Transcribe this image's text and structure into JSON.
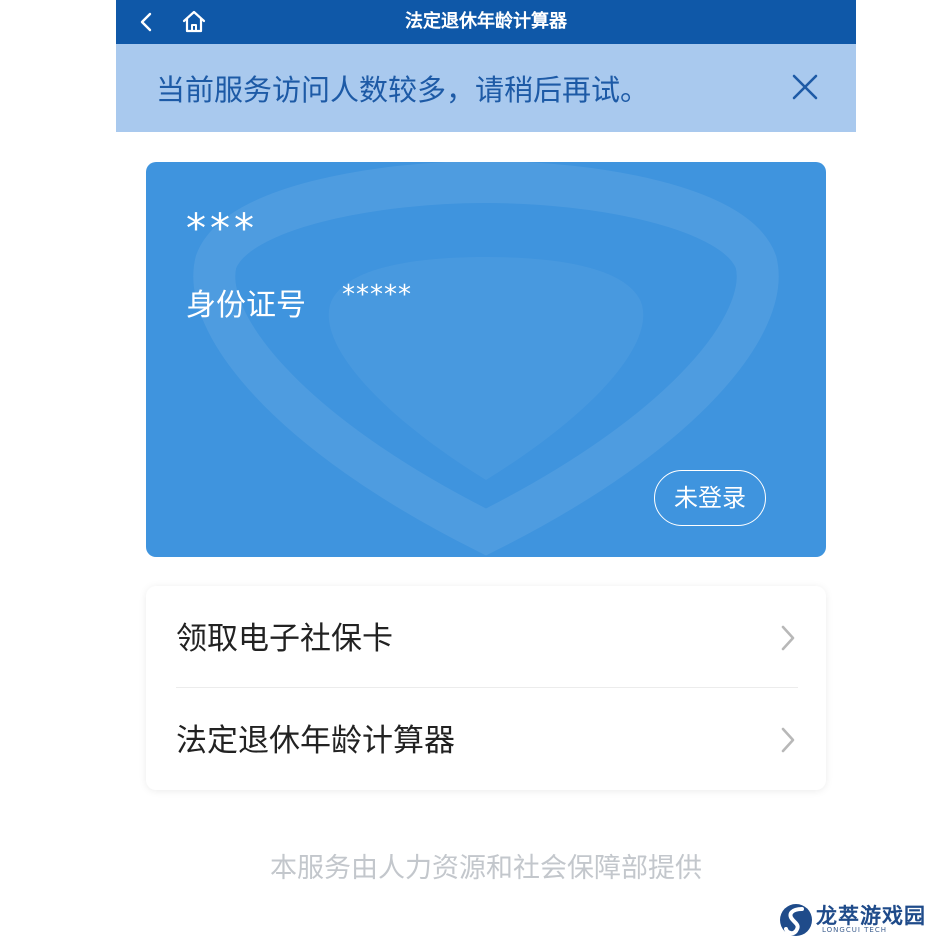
{
  "colors": {
    "topbar": "#0f58a8",
    "notice_bg": "#a9c9ee",
    "notice_text": "#1d5aa6",
    "card_bg": "#3f94de",
    "footer_text": "#c3c7cc"
  },
  "topbar": {
    "title": "法定退休年龄计算器",
    "back_icon": "chevron-left-icon",
    "home_icon": "home-icon"
  },
  "notice": {
    "text": "当前服务访问人数较多，请稍后再试。",
    "close_icon": "close-icon"
  },
  "card": {
    "name": "***",
    "id_label": "身份证号",
    "id_value": "*****",
    "login_label": "未登录"
  },
  "menu": {
    "items": [
      {
        "label": "领取电子社保卡",
        "icon": "chevron-right-icon"
      },
      {
        "label": "法定退休年龄计算器",
        "icon": "chevron-right-icon"
      }
    ]
  },
  "footer": {
    "text": "本服务由人力资源和社会保障部提供"
  },
  "watermark": {
    "title": "龙萃游戏园",
    "subtitle": "LONGCUI TECH"
  }
}
